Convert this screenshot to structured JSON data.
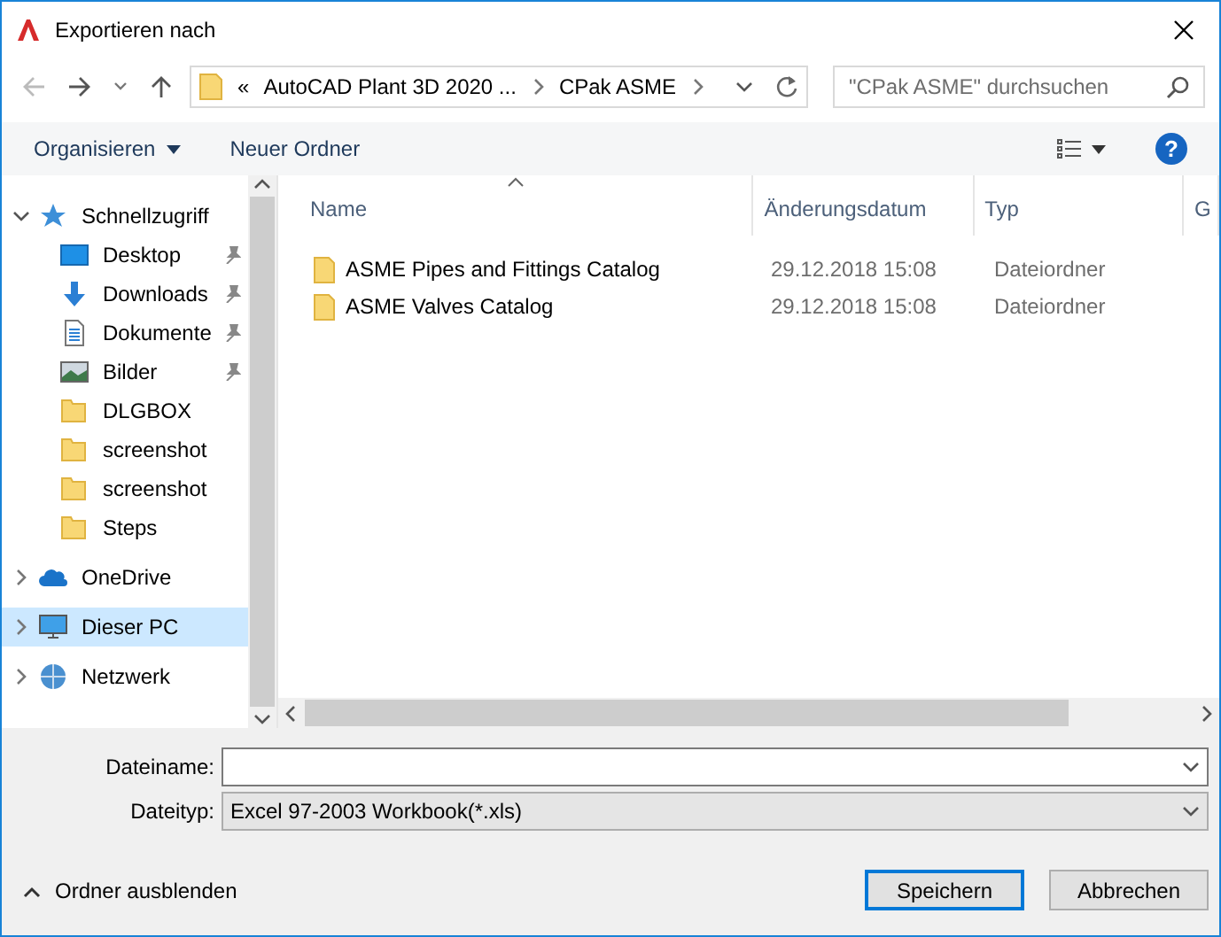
{
  "window": {
    "title": "Exportieren nach"
  },
  "address": {
    "overflow": "«",
    "crumbs": [
      "AutoCAD Plant 3D 2020 ...",
      "CPak ASME"
    ]
  },
  "search": {
    "placeholder": "\"CPak ASME\" durchsuchen"
  },
  "toolbar": {
    "organize": "Organisieren",
    "new_folder": "Neuer Ordner",
    "help": "?"
  },
  "sidebar": {
    "items": [
      {
        "label": "Schnellzugriff",
        "kind": "star",
        "expanded": true,
        "selected": false,
        "children": [
          {
            "label": "Desktop",
            "kind": "desktop",
            "pinned": true,
            "selected": false
          },
          {
            "label": "Downloads",
            "kind": "download",
            "pinned": true,
            "selected": false
          },
          {
            "label": "Dokumente",
            "kind": "document",
            "pinned": true,
            "selected": false
          },
          {
            "label": "Bilder",
            "kind": "pictures",
            "pinned": true,
            "selected": false
          },
          {
            "label": "DLGBOX",
            "kind": "folder",
            "pinned": false,
            "selected": false
          },
          {
            "label": "screenshot",
            "kind": "folder",
            "pinned": false,
            "selected": false
          },
          {
            "label": "screenshot",
            "kind": "folder",
            "pinned": false,
            "selected": false
          },
          {
            "label": "Steps",
            "kind": "folder",
            "pinned": false,
            "selected": false
          }
        ]
      },
      {
        "label": "OneDrive",
        "kind": "cloud",
        "expanded": false,
        "selected": false
      },
      {
        "label": "Dieser PC",
        "kind": "pc",
        "expanded": false,
        "selected": true
      },
      {
        "label": "Netzwerk",
        "kind": "network",
        "expanded": false,
        "selected": false
      }
    ]
  },
  "table": {
    "columns": [
      {
        "label": "Name",
        "sorted": true
      },
      {
        "label": "Änderungsdatum",
        "sorted": false
      },
      {
        "label": "Typ",
        "sorted": false
      },
      {
        "label": "G",
        "sorted": false
      }
    ],
    "rows": [
      {
        "name": "ASME Pipes and Fittings Catalog",
        "date": "29.12.2018 15:08",
        "type": "Dateiordner"
      },
      {
        "name": "ASME Valves Catalog",
        "date": "29.12.2018 15:08",
        "type": "Dateiordner"
      }
    ]
  },
  "filename": {
    "label": "Dateiname:"
  },
  "filetype": {
    "label": "Dateityp:",
    "value": "Excel 97-2003 Workbook(*.xls)"
  },
  "hide_folders": "Ordner ausblenden",
  "buttons": [
    {
      "label": "Speichern",
      "default": true
    },
    {
      "label": "Abbrechen",
      "default": false
    }
  ]
}
